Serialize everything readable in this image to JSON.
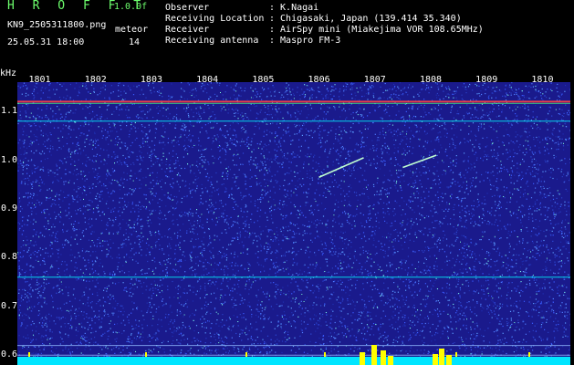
{
  "header": {
    "title": "H R O F F T",
    "version": "1.0.0f",
    "filename": "KN9_2505311800.png",
    "meteor_label": "meteor",
    "datetime": "25.05.31 18:00",
    "count": "14",
    "info": [
      {
        "key": "Observer",
        "value": ": K.Nagai"
      },
      {
        "key": "Receiving Location",
        "value": ": Chigasaki, Japan (139.414 35.340)"
      },
      {
        "key": "Receiver",
        "value": ": AirSpy mini (Miakejima VOR 108.65MHz)"
      },
      {
        "key": "Receiving antenna",
        "value": ": Maspro FM-3"
      }
    ]
  },
  "chart_data": {
    "type": "heatmap",
    "ylabel": "kHz",
    "x_ticks": [
      "1801",
      "1802",
      "1803",
      "1804",
      "1805",
      "1806",
      "1807",
      "1808",
      "1809",
      "1810"
    ],
    "y_ticks": [
      "1.1",
      "1.0",
      "0.9",
      "0.8",
      "0.7",
      "0.6"
    ],
    "ylim": [
      0.58,
      1.16
    ],
    "horizontal_lines_khz": [
      1.12,
      1.08,
      0.76,
      0.62,
      0.6
    ],
    "meteor_echoes": [
      {
        "x_start_min": 1806.0,
        "y_start_khz": 0.965,
        "x_end_min": 1806.8,
        "y_end_khz": 1.005
      },
      {
        "x_start_min": 1807.5,
        "y_start_khz": 0.985,
        "x_end_min": 1808.1,
        "y_end_khz": 1.01
      }
    ],
    "colors": {
      "background": "#1a1a8c",
      "noise": "#3a5cff",
      "line": "#00ffff",
      "hot": "#ffff00",
      "carrier": "#ff4040"
    }
  }
}
